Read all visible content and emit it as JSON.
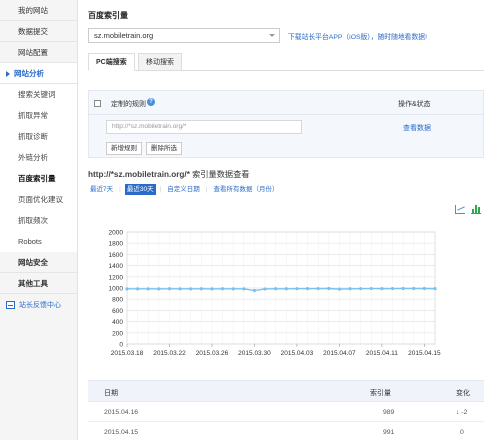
{
  "sidebar": {
    "items_top": [
      {
        "label": "我的网站"
      },
      {
        "label": "数据提交"
      },
      {
        "label": "网站配置"
      }
    ],
    "active_section": "网站分析",
    "sub_items": [
      {
        "label": "搜索关键词"
      },
      {
        "label": "抓取异常"
      },
      {
        "label": "抓取诊断"
      },
      {
        "label": "外链分析"
      },
      {
        "label": "百度索引量"
      },
      {
        "label": "页面优化建议"
      },
      {
        "label": "抓取频次"
      },
      {
        "label": "Robots"
      }
    ],
    "items_bottom": [
      {
        "label": "网站安全"
      },
      {
        "label": "其他工具"
      }
    ],
    "feedback": "站长反馈中心"
  },
  "header": {
    "title": "百度索引量",
    "site": "sz.mobiletrain.org",
    "promo": "下载站长平台APP（iOS版），随时随地看数据!"
  },
  "tabs": [
    "PC端搜索",
    "移动搜索"
  ],
  "rules": {
    "header_label": "定制的规则",
    "op_label": "操作&状态",
    "placeholder": "http://*sz.mobiletrain.org/*",
    "view_link": "查看数据",
    "add_button": "新增规则",
    "delete_button": "删除所选"
  },
  "query": {
    "url": "http://*sz.mobiletrain.org/*",
    "suffix": " 索引量数据查看"
  },
  "ranges": [
    "最近7天",
    "最近30天",
    "自定义日期",
    "查看所有数据（月份）"
  ],
  "chart_data": {
    "type": "line",
    "x": [
      "2015.03.18",
      "2015.03.19",
      "2015.03.20",
      "2015.03.21",
      "2015.03.22",
      "2015.03.23",
      "2015.03.24",
      "2015.03.25",
      "2015.03.26",
      "2015.03.27",
      "2015.03.28",
      "2015.03.29",
      "2015.03.30",
      "2015.03.31",
      "2015.04.01",
      "2015.04.02",
      "2015.04.03",
      "2015.04.04",
      "2015.04.05",
      "2015.04.06",
      "2015.04.07",
      "2015.04.08",
      "2015.04.09",
      "2015.04.10",
      "2015.04.11",
      "2015.04.12",
      "2015.04.13",
      "2015.04.14",
      "2015.04.15",
      "2015.04.16"
    ],
    "x_ticks": [
      "2015.03.18",
      "2015.03.22",
      "2015.03.26",
      "2015.03.30",
      "2015.04.03",
      "2015.04.07",
      "2015.04.11",
      "2015.04.15"
    ],
    "values": [
      985,
      985,
      985,
      984,
      986,
      985,
      985,
      986,
      984,
      986,
      985,
      985,
      955,
      983,
      986,
      986,
      988,
      989,
      990,
      991,
      980,
      986,
      988,
      990,
      989,
      990,
      991,
      991,
      991,
      989
    ],
    "ylim": [
      0,
      2000
    ],
    "y_ticks": [
      0,
      200,
      400,
      600,
      800,
      1000,
      1200,
      1400,
      1600,
      1800,
      2000
    ],
    "grid": true,
    "color": "#7cc0f0"
  },
  "table": {
    "headers": [
      "日期",
      "索引量",
      "变化"
    ],
    "rows": [
      {
        "date": "2015.04.16",
        "count": "989",
        "change": "2",
        "dir": "down"
      },
      {
        "date": "2015.04.15",
        "count": "991",
        "change": "0",
        "dir": ""
      }
    ]
  }
}
